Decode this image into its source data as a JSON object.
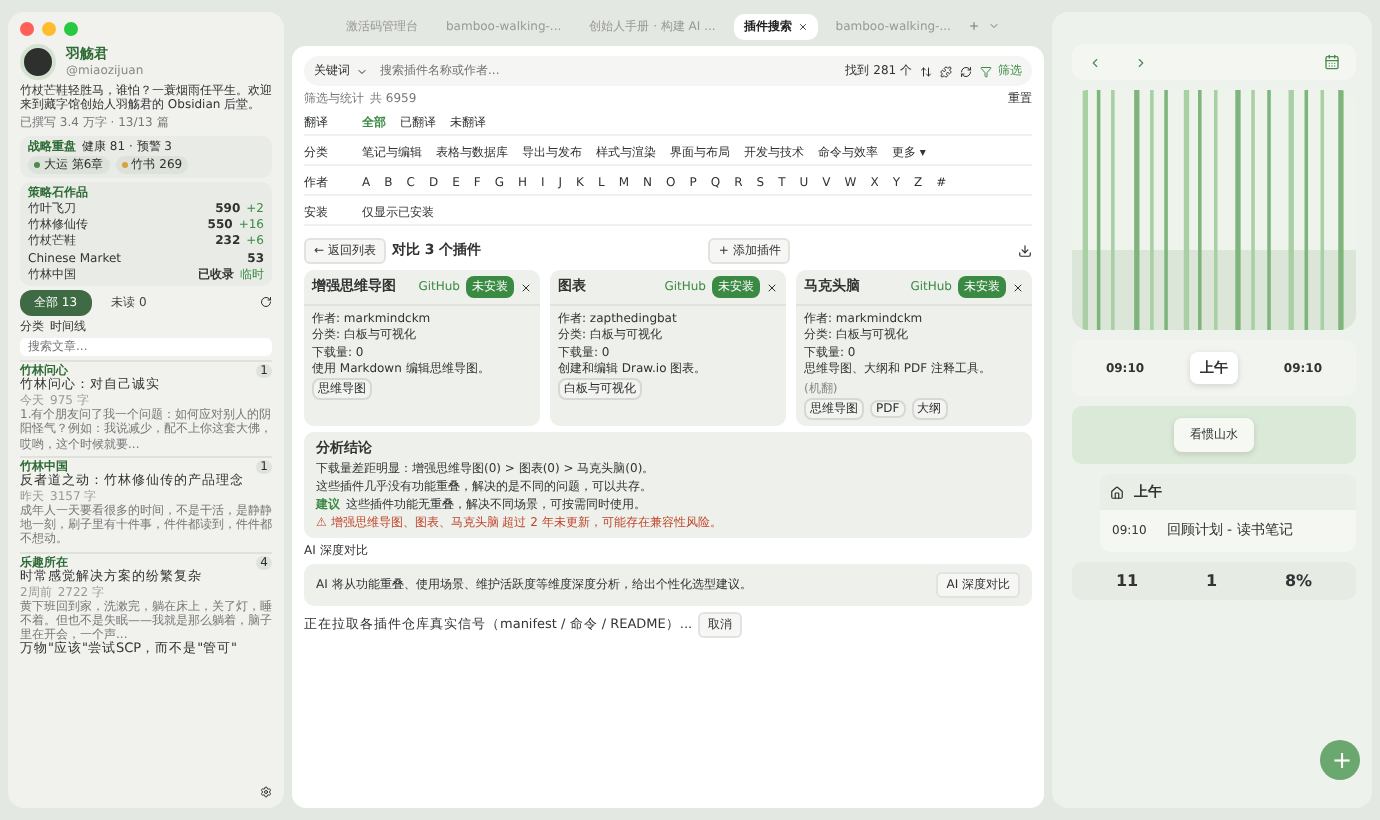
{
  "sidebar": {
    "profile": {
      "name": "羽觞君",
      "handle": "@miaozijuan",
      "bio": "竹杖芒鞋轻胜马，谁怕？一蓑烟雨任平生。欢迎来到藏字馆创始人羽觞君的 Obsidian 后堂。",
      "stats": "已撰写 3.4 万字 · 13/13 篇"
    },
    "strategy": {
      "title": "战略重盘",
      "health": "健康 81 · 预警 3",
      "chips": [
        {
          "label": "大运 第6章",
          "color": "#4a8a4f"
        },
        {
          "label": "竹书 269",
          "color": "#d9a23a"
        }
      ]
    },
    "works": {
      "title": "策略石作品",
      "items": [
        {
          "name": "竹叶飞刀",
          "value": "590",
          "delta": "+2"
        },
        {
          "name": "竹林修仙传",
          "value": "550",
          "delta": "+16"
        },
        {
          "name": "竹杖芒鞋",
          "value": "232",
          "delta": "+6"
        },
        {
          "name": "Chinese Market",
          "value": "53"
        },
        {
          "name": "竹林中国",
          "value": "已收录",
          "delta": "临时"
        }
      ]
    },
    "tabs": [
      {
        "label": "全部 13",
        "selected": true
      },
      {
        "label": "未读 0",
        "selected": false
      }
    ],
    "views": [
      "分类",
      "时间线"
    ],
    "search": {
      "placeholder": "搜索文章..."
    },
    "groups": [
      {
        "name": "竹林问心",
        "count": "1",
        "articles": [
          {
            "title": "竹林问心：对自己诚实",
            "date": "今天",
            "words": "975 字",
            "excerpt": "1.有个朋友问了我一个问题：如何应对别人的阴阳怪气？例如：我说减少，配不上你这套大佛，哎哟，这个时候就要..."
          }
        ]
      },
      {
        "name": "竹林中国",
        "count": "1",
        "articles": [
          {
            "title": "反者道之动：竹林修仙传的产品理念",
            "date": "昨天",
            "words": "3157 字",
            "excerpt": "成年人一天要看很多的时间，不是干活，是静静地一刻，刷子里有十件事，件件都读到，件件都不想动。"
          }
        ]
      },
      {
        "name": "乐趣所在",
        "count": "4",
        "articles": [
          {
            "title": "时常感觉解决方案的纷繁复杂",
            "date": "2周前",
            "words": "2722 字",
            "excerpt": "黄下班回到家，洗漱完，躺在床上，关了灯，睡不着。但也不是失眠——我就是那么躺着，脑子里在开会，一个声..."
          },
          {
            "title": "万物\"应该\"尝试SCP，而不是\"管可\""
          }
        ]
      }
    ]
  },
  "browser_tabs": [
    {
      "label": "激活码管理台",
      "selected": false
    },
    {
      "label": "bamboo-walking-...",
      "selected": false
    },
    {
      "label": "创始人手册 · 构建 AI ...",
      "selected": false
    },
    {
      "label": "插件搜索",
      "selected": true
    },
    {
      "label": "bamboo-walking-...",
      "selected": false
    }
  ],
  "search_bar": {
    "mode": "关键词",
    "placeholder": "搜索插件名称或作者...",
    "result": "找到 281 个",
    "filter": "筛选"
  },
  "filters": {
    "title": "筛选与统计",
    "total": "共 6959",
    "reset": "重置",
    "rows": [
      {
        "label": "翻译",
        "options": [
          {
            "label": "全部",
            "selected": true
          },
          {
            "label": "已翻译",
            "selected": false
          },
          {
            "label": "未翻译",
            "selected": false
          }
        ]
      },
      {
        "label": "分类",
        "options": [
          {
            "label": "笔记与编辑",
            "selected": false
          },
          {
            "label": "表格与数据库",
            "selected": false
          },
          {
            "label": "导出与发布",
            "selected": false
          },
          {
            "label": "样式与渲染",
            "selected": false
          },
          {
            "label": "界面与布局",
            "selected": false
          },
          {
            "label": "开发与技术",
            "selected": false
          },
          {
            "label": "命令与效率",
            "selected": false
          },
          {
            "label": "更多 ▾",
            "selected": false
          }
        ]
      },
      {
        "label": "作者",
        "options": [
          {
            "label": "A",
            "selected": false
          },
          {
            "label": "B",
            "selected": false
          },
          {
            "label": "C",
            "selected": false
          },
          {
            "label": "D",
            "selected": false
          },
          {
            "label": "E",
            "selected": false
          },
          {
            "label": "F",
            "selected": false
          },
          {
            "label": "G",
            "selected": false
          },
          {
            "label": "H",
            "selected": false
          },
          {
            "label": "I",
            "selected": false
          },
          {
            "label": "J",
            "selected": false
          },
          {
            "label": "K",
            "selected": false
          },
          {
            "label": "L",
            "selected": false
          },
          {
            "label": "M",
            "selected": false
          },
          {
            "label": "N",
            "selected": false
          },
          {
            "label": "O",
            "selected": false
          },
          {
            "label": "P",
            "selected": false
          },
          {
            "label": "Q",
            "selected": false
          },
          {
            "label": "R",
            "selected": false
          },
          {
            "label": "S",
            "selected": false
          },
          {
            "label": "T",
            "selected": false
          },
          {
            "label": "U",
            "selected": false
          },
          {
            "label": "V",
            "selected": false
          },
          {
            "label": "W",
            "selected": false
          },
          {
            "label": "X",
            "selected": false
          },
          {
            "label": "Y",
            "selected": false
          },
          {
            "label": "Z",
            "selected": false
          },
          {
            "label": "#",
            "selected": false
          }
        ]
      },
      {
        "label": "安装",
        "options": [
          {
            "label": "仅显示已安装",
            "selected": false
          }
        ]
      }
    ]
  },
  "compare": {
    "back": "← 返回列表",
    "title": "对比 3 个插件",
    "add": "+ 添加插件",
    "cards": [
      {
        "name": "增强思维导图",
        "source": "GitHub",
        "status": "未安装",
        "lines": [
          "作者: markmindckm",
          "分类: 白板与可视化",
          "下载量: 0"
        ],
        "desc": "使用 Markdown 编辑思维导图。",
        "tags": [
          "思维导图"
        ]
      },
      {
        "name": "图表",
        "source": "GitHub",
        "status": "未安装",
        "lines": [
          "作者: zapthedingbat",
          "分类: 白板与可视化",
          "下载量: 0"
        ],
        "desc": "创建和编辑 Draw.io 图表。",
        "tags": [
          "白板与可视化"
        ]
      },
      {
        "name": "马克头脑",
        "source": "GitHub",
        "status": "未安装",
        "lines": [
          "作者: markmindckm",
          "分类: 白板与可视化",
          "下载量: 0"
        ],
        "desc": "思维导图、大纲和 PDF 注释工具。",
        "note": "(机翻)",
        "tags": [
          "思维导图",
          "PDF",
          "大纲"
        ]
      }
    ]
  },
  "analysis": {
    "title": "分析结论",
    "lines": [
      "下载量差距明显：增强思维导图(0) > 图表(0) > 马克头脑(0)。",
      "这些插件几乎没有功能重叠，解决的是不同的问题，可以共存。"
    ],
    "advice_label": "建议",
    "advice": "这些插件功能无重叠，解决不同场景，可按需同时使用。",
    "warning": "⚠ 增强思维导图、图表、马克头脑 超过 2 年未更新，可能存在兼容性风险。"
  },
  "ai": {
    "label": "AI 深度对比",
    "desc": "AI 将从功能重叠、使用场景、维护活跃度等维度深度分析，给出个性化选型建议。",
    "button": "AI 深度对比"
  },
  "loading": {
    "text": "正在拉取各插件仓库真实信号（manifest / 命令 / README）...",
    "cancel": "取消"
  },
  "right": {
    "times": [
      {
        "label": "09:10",
        "selected": false
      },
      {
        "label": "上午",
        "selected": true
      },
      {
        "label": "09:10",
        "selected": false
      }
    ],
    "mood": "看惯山水",
    "period": "上午",
    "entry_time": "09:10",
    "entry_title": "回顾计划 - 读书笔记",
    "stats": [
      "11",
      "1",
      "8%"
    ],
    "fab": "+"
  }
}
